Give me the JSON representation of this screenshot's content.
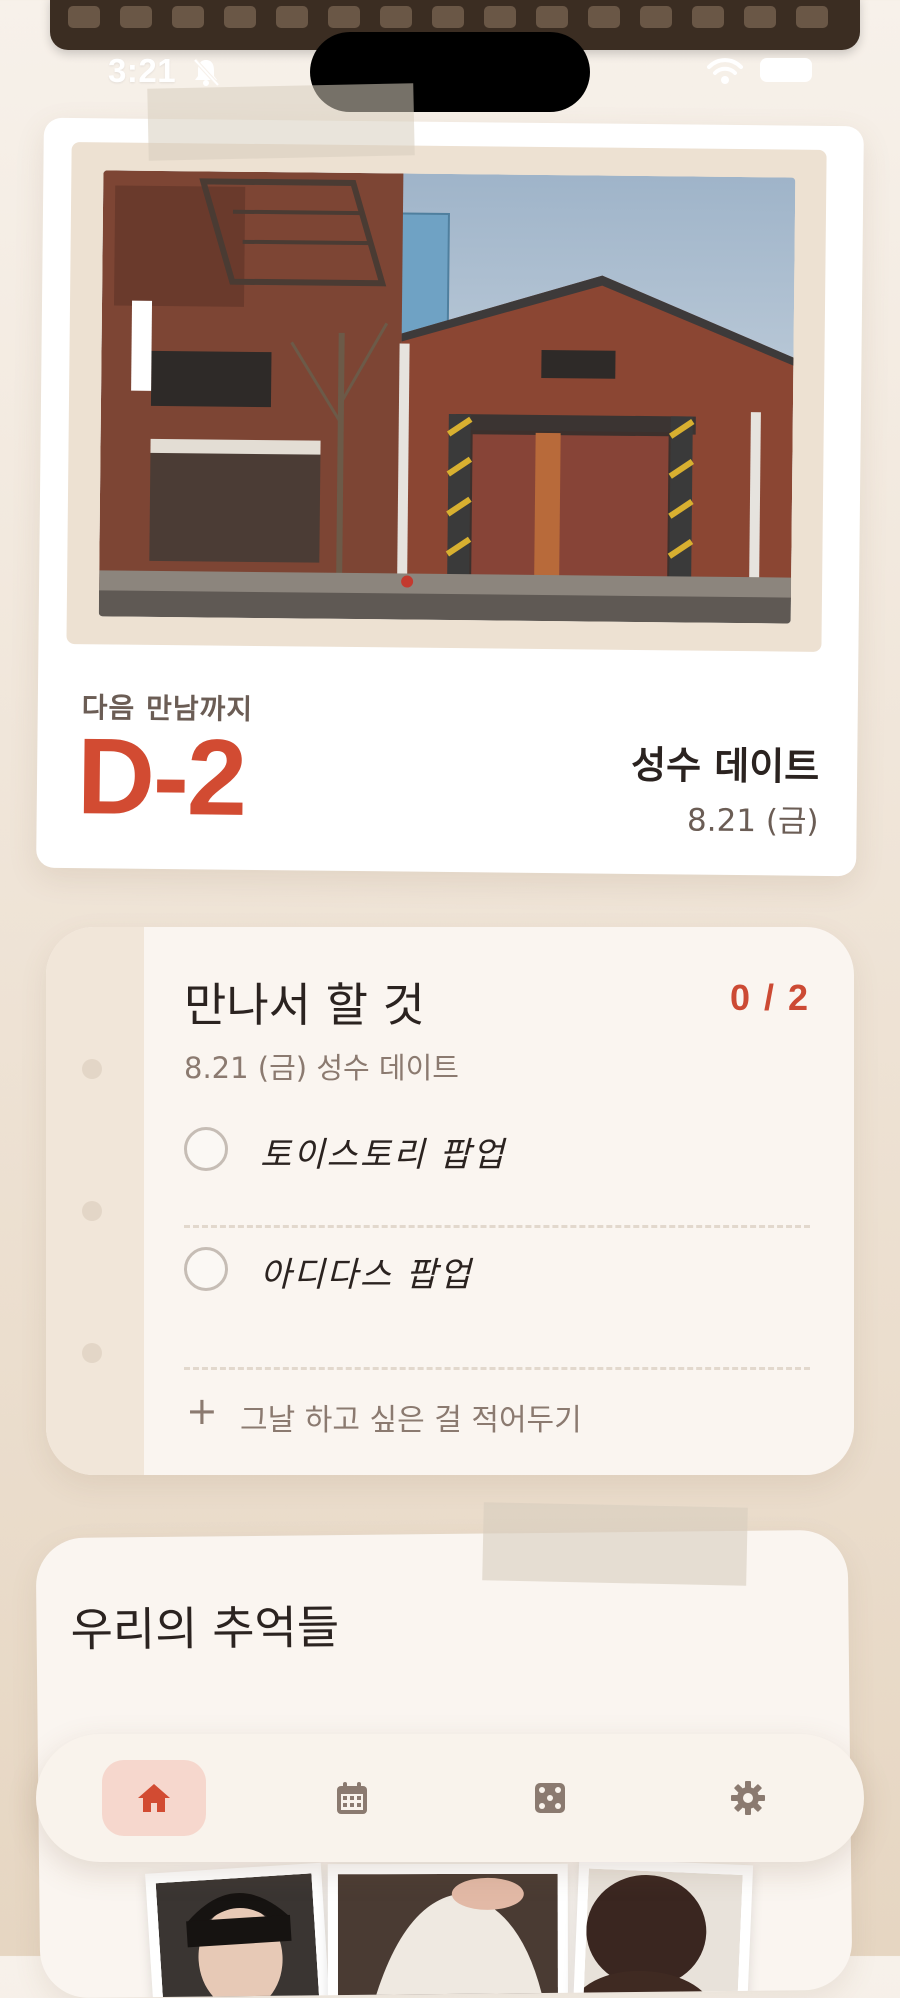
{
  "status_bar": {
    "time": "3:21"
  },
  "countdown_card": {
    "label": "다음  만남까지",
    "value": "D-2",
    "event_title": "성수 데이트",
    "event_date": "8.21 (금)"
  },
  "todo": {
    "title": "만나서 할 것",
    "progress": "0 / 2",
    "subtitle": "8.21 (금) 성수 데이트",
    "items": [
      {
        "label": "토이스토리 팝업",
        "checked": false
      },
      {
        "label": "아디다스 팝업",
        "checked": false
      }
    ],
    "add_placeholder": "그날 하고 싶은 걸 적어두기",
    "add_symbol": "+"
  },
  "memories": {
    "title": "우리의 추억들"
  },
  "nav": {
    "items": [
      {
        "icon": "home-icon",
        "active": true
      },
      {
        "icon": "calendar-icon",
        "active": false
      },
      {
        "icon": "dice-icon",
        "active": false
      },
      {
        "icon": "gear-icon",
        "active": false
      }
    ]
  },
  "colors": {
    "accent": "#d24b32",
    "background": "#f3ebe1",
    "card": "#ffffff",
    "muted_text": "#8b7a70",
    "nav_active_bg": "#f6d7cd"
  }
}
